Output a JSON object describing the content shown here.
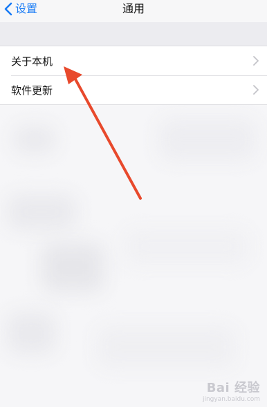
{
  "nav": {
    "back_label": "设置",
    "title": "通用"
  },
  "list": {
    "items": [
      {
        "label": "关于本机"
      },
      {
        "label": "软件更新"
      }
    ]
  },
  "watermark": {
    "main": "Bai 经验",
    "sub": "jingyan.baidu.com"
  },
  "colors": {
    "accent": "#1a7cf5",
    "arrow": "#e8492c"
  },
  "icons": {
    "back": "chevron-left-icon",
    "row_arrow": "chevron-right-icon",
    "annotation": "red-arrow"
  }
}
